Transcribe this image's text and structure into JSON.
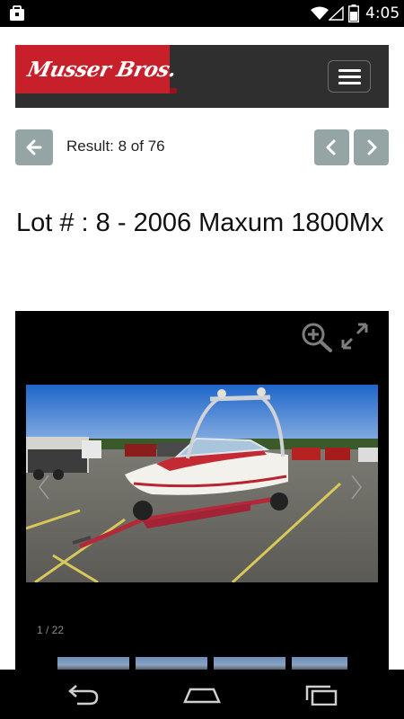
{
  "status_bar": {
    "time": "4:05",
    "icons": [
      "notification-icon",
      "wifi-icon",
      "signal-icon",
      "battery-icon"
    ]
  },
  "header": {
    "logo_text": "Musser Bros.",
    "menu_icon": "hamburger-menu-icon",
    "colors": {
      "bar": "#2f2f2f",
      "logo": "#c8202a"
    }
  },
  "navigation": {
    "result_text": "Result: 8 of 76",
    "back_icon": "arrow-left-icon",
    "prev_icon": "chevron-left-icon",
    "next_icon": "chevron-right-icon",
    "button_color": "#95a5a6"
  },
  "lot": {
    "title": "Lot # : 8 - 2006 Maxum 1800Mx"
  },
  "gallery": {
    "counter": "1 / 22",
    "zoom_icon": "zoom-in-icon",
    "fullscreen_icon": "fullscreen-icon",
    "thumbnail_count": 4
  },
  "system_nav": {
    "icons": [
      "back-icon",
      "home-icon",
      "recents-icon"
    ]
  }
}
